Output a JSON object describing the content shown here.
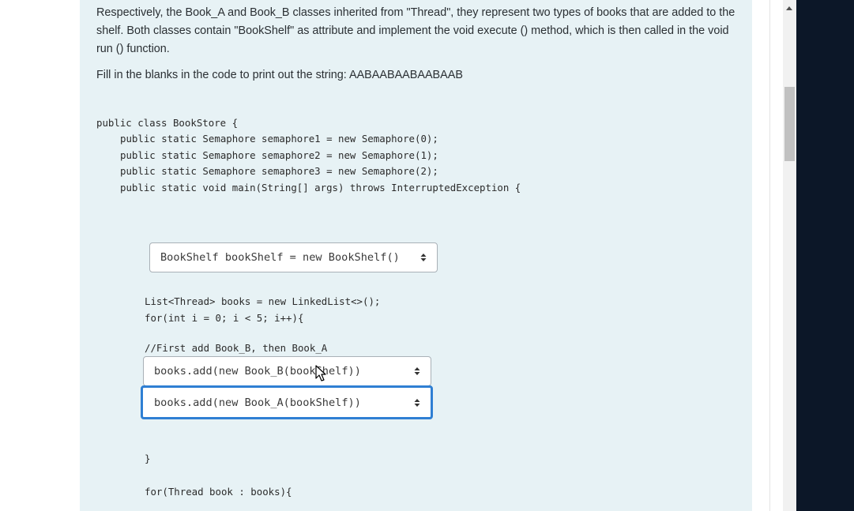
{
  "description": {
    "paragraph1": "Respectively, the Book_A and Book_B classes inherited from \"Thread\", they represent two types of books that are added to the shelf. Both classes contain \"BookShelf\" as attribute and implement the void execute () method, which is then called in the void run () function.",
    "paragraph2": "Fill in the blanks in the code to print out the string: AABAABAABAABAAB"
  },
  "code": {
    "class_decl": "public class BookStore {",
    "sem1": "public static Semaphore semaphore1 = new Semaphore(0);",
    "sem2": "public static Semaphore semaphore2 = new Semaphore(1);",
    "sem3": "public static Semaphore semaphore3 = new Semaphore(2);",
    "main": "public static void main(String[] args) throws InterruptedException {",
    "list": "List<Thread> books = new LinkedList<>();",
    "for_loop": "for(int i = 0; i < 5; i++){",
    "comment": "//First add Book_B, then Book_A",
    "close_brace": "}",
    "for_each": "for(Thread book : books){"
  },
  "selects": {
    "bookshelf": "BookShelf bookShelf = new BookShelf()",
    "add_b": "books.add(new Book_B(bookShelf))",
    "add_a": "books.add(new Book_A(bookShelf))"
  }
}
